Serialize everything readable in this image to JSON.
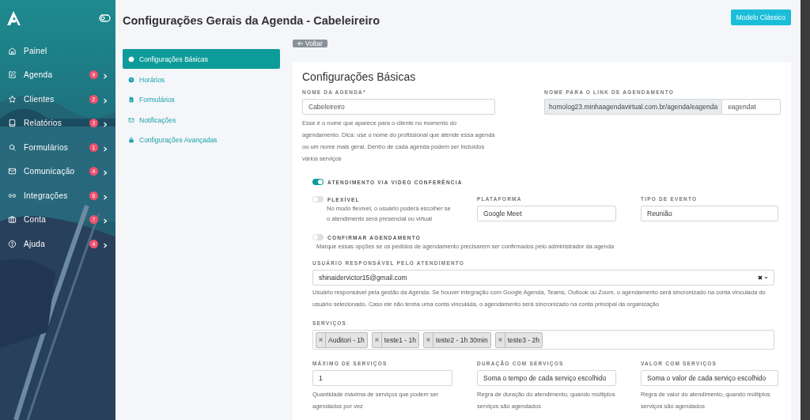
{
  "sidebar": {
    "items": [
      {
        "label": "Painel"
      },
      {
        "label": "Agenda",
        "badge": "9"
      },
      {
        "label": "Clientes",
        "badge": "2"
      },
      {
        "label": "Relatórios",
        "badge": "3"
      },
      {
        "label": "Formulários",
        "badge": "1"
      },
      {
        "label": "Comunicação",
        "badge": "4"
      },
      {
        "label": "Integrações",
        "badge": "6"
      },
      {
        "label": "Conta",
        "badge": "7"
      },
      {
        "label": "Ajuda",
        "badge": "4"
      }
    ]
  },
  "header": {
    "title": "Configurações Gerais da Agenda - Cabeleireiro",
    "button": "Modelo Clássico"
  },
  "settings_nav": {
    "items": [
      {
        "label": "Configurações Básicas",
        "selected": true
      },
      {
        "label": "Horários",
        "selected": false
      },
      {
        "label": "Formulários",
        "selected": false
      },
      {
        "label": "Notificações",
        "selected": false
      },
      {
        "label": "Configurações Avançadas",
        "selected": false
      }
    ]
  },
  "back_button": "Voltar",
  "card": {
    "title": "Configurações Básicas",
    "agenda_name": {
      "label": "NOME DA AGENDA*",
      "value": "Cabeleireiro",
      "help": "Esse é o nome que aparece para o cliente no momento do agendamento. Dica: use o nome do profissional que atende essa agenda ou um nome mais geral. Dentro de cada agenda podem ser incluídos vários serviços"
    },
    "link_name": {
      "label": "NOME PARA O LINK DE AGENDAMENTO",
      "prefix": "homolog23.minhaagendavirtual.com.br/agenda/eagenda",
      "value": "eagendat"
    },
    "video": {
      "label": "ATENDIMENTO VIA VIDEO CONFERÊNCIA",
      "on": true
    },
    "flexible": {
      "label": "FLEXÍVEL",
      "on": false,
      "help": "No modo flexível, o usuário poderá escolher se o atendimento será presencial ou virtual"
    },
    "platform": {
      "label": "PLATAFORMA",
      "value": "Google Meet"
    },
    "event_type": {
      "label": "TIPO DE EVENTO",
      "value": "Reunião"
    },
    "confirm": {
      "label": "CONFIRMAR AGENDAMENTO",
      "on": false,
      "help": "Marque essas opções se os pedidos de agendamento precisarem ser confirmados pelo administrador da agenda"
    },
    "user": {
      "label": "USUÁRIO RESPONSÁVEL PELO ATENDIMENTO",
      "value": "shinaidervictor15@gmail.com",
      "help": "Usuário responsável pela gestão da Agenda. Se houver integração com Google Agenda, Teams, Outlook ou Zoom, o agendamento será sincronizado na conta vinculada do usuário selecionado. Caso ele não tenha uma conta vinculada, o agendamento será sincronizado na conta principal da organização"
    },
    "services": {
      "label": "SERVIÇOS",
      "tags": [
        "Auditori - 1h",
        "teste1 - 1h",
        "teste2 - 1h 30min",
        "teste3 - 2h"
      ]
    },
    "bottom_fields": [
      {
        "label": "MÁXIMO DE SERVIÇOS",
        "value": "1",
        "help": "Quantidade máxima de serviços que podem ser agendados por vez"
      },
      {
        "label": "DURAÇÃO COM SERVIÇOS",
        "value": "Soma o tempo de cada serviço escolhido",
        "help": "Regra de duração do atendimento, quando múltiplos serviços são agendados"
      },
      {
        "label": "VALOR COM SERVIÇOS",
        "value": "Soma o valor de cada serviço escolhido",
        "help": "Regra de valor do atendimento, quando múltiplos serviços são agendados"
      }
    ]
  }
}
